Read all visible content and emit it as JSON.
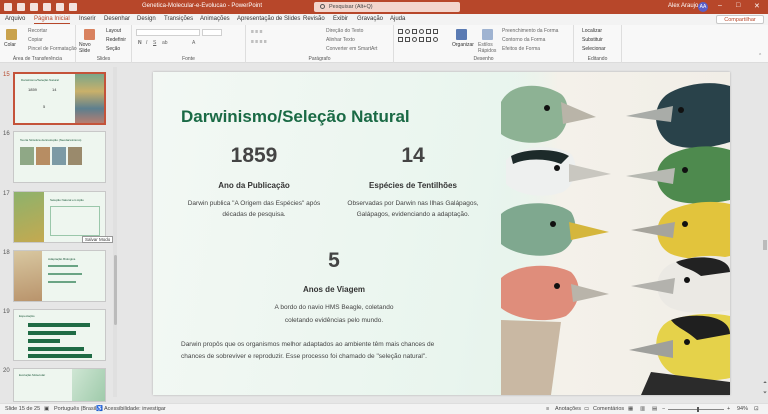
{
  "titlebar": {
    "title": "Genetica-Molecular-e-Evolucao  -  PowerPoint",
    "search": "Pesquisar (Alt+Q)",
    "user": "Alex Araujo",
    "initials": "AA"
  },
  "menu": {
    "tabs": [
      "Arquivo",
      "Página Inicial",
      "Inserir",
      "Desenhar",
      "Design",
      "Transições",
      "Animações",
      "Apresentação de Slides",
      "Revisão",
      "Exibir",
      "Gravação",
      "Ajuda"
    ],
    "active": "Página Inicial",
    "share": "Compartilhar"
  },
  "ribbon": {
    "clipboard": {
      "paste": "Colar",
      "cut": "Recortar",
      "copy": "Copiar",
      "format": "Pincel de Formatação",
      "label": "Área de Transferência"
    },
    "slides": {
      "new": "Novo Slide",
      "layout": "Layout",
      "reset": "Redefinir",
      "section": "Seção",
      "label": "Slides"
    },
    "font": {
      "label": "Fonte"
    },
    "paragraph": {
      "direction": "Direção do Texto",
      "align": "Alinhar Texto",
      "smartart": "Converter em SmartArt",
      "label": "Parágrafo"
    },
    "drawing": {
      "arrange": "Organizar",
      "styles": "Estilos Rápidos",
      "fill": "Preenchimento da Forma",
      "outline": "Contorno da Forma",
      "effects": "Efeitos de Forma",
      "label": "Desenho"
    },
    "editing": {
      "find": "Localizar",
      "replace": "Substituir",
      "select": "Selecionar",
      "label": "Editando"
    }
  },
  "thumbnails": [
    {
      "num": "15",
      "title": "Darwinismo/Seleção Natural",
      "selected": true
    },
    {
      "num": "16",
      "title": "Teoria Sintética da Evolução (Neodarwinismo)",
      "selected": false
    },
    {
      "num": "17",
      "title": "Seleção Natural em Ação",
      "selected": false
    },
    {
      "num": "18",
      "title": "Adaptação Biológica",
      "selected": false
    },
    {
      "num": "19",
      "title": "Especiação",
      "selected": false
    },
    {
      "num": "20",
      "title": "Evolução Molecular",
      "selected": false
    }
  ],
  "thumb_tooltip": "Salvar Modo",
  "slide": {
    "title": "Darwinismo/Seleção Natural",
    "stats": [
      {
        "number": "1859",
        "label": "Ano da Publicação",
        "desc1": "Darwin publica \"A Origem das Espécies\" após",
        "desc2": "décadas de pesquisa."
      },
      {
        "number": "14",
        "label": "Espécies de Tentilhões",
        "desc1": "Observadas por Darwin nas Ilhas Galápagos,",
        "desc2": "Galápagos, evidenciando a adaptação."
      },
      {
        "number": "5",
        "label": "Anos de Viagem",
        "desc1": "A bordo do navio HMS Beagle, coletando",
        "desc2": "coletando evidências pelo mundo."
      }
    ],
    "conclusion1": "Darwin propôs que os organismos melhor adaptados ao ambiente têm mais chances de",
    "conclusion2": "chances de sobreviver e reproduzir. Esse processo foi chamado de \"seleção natural\"."
  },
  "statusbar": {
    "slide_info": "Slide 15 de 25",
    "language": "Português (Brasil)",
    "accessibility": "Acessibilidade: investigar",
    "notes": "Anotações",
    "comments": "Comentários",
    "zoom": "94%"
  },
  "colors": {
    "accent": "#b7472a",
    "title_green": "#1a6a45"
  }
}
